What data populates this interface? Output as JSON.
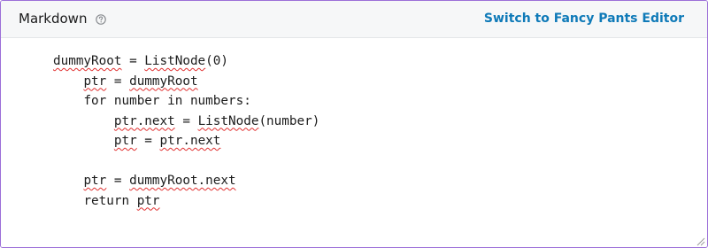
{
  "header": {
    "mode_label": "Markdown",
    "help_icon": "help-circle-icon",
    "switch_label": "Switch to Fancy Pants Editor"
  },
  "editor": {
    "lines": [
      {
        "indent": "",
        "segments": [
          {
            "text": "dummyRoot",
            "misspelled": true
          },
          {
            "text": " = "
          },
          {
            "text": "ListNode",
            "misspelled": true
          },
          {
            "text": "(0)"
          }
        ]
      },
      {
        "indent": "    ",
        "segments": [
          {
            "text": "ptr",
            "misspelled": true
          },
          {
            "text": " = "
          },
          {
            "text": "dummyRoot",
            "misspelled": true
          }
        ]
      },
      {
        "indent": "    ",
        "segments": [
          {
            "text": "for number in numbers:"
          }
        ]
      },
      {
        "indent": "        ",
        "segments": [
          {
            "text": "ptr.next",
            "misspelled": true
          },
          {
            "text": " = "
          },
          {
            "text": "ListNode",
            "misspelled": true
          },
          {
            "text": "(number)"
          }
        ]
      },
      {
        "indent": "        ",
        "segments": [
          {
            "text": "ptr",
            "misspelled": true
          },
          {
            "text": " = "
          },
          {
            "text": "ptr.next",
            "misspelled": true
          }
        ]
      },
      {
        "indent": "",
        "segments": []
      },
      {
        "indent": "    ",
        "segments": [
          {
            "text": "ptr",
            "misspelled": true
          },
          {
            "text": " = "
          },
          {
            "text": "dummyRoot.next",
            "misspelled": true
          }
        ]
      },
      {
        "indent": "    ",
        "segments": [
          {
            "text": "return "
          },
          {
            "text": "ptr",
            "misspelled": true
          }
        ]
      }
    ]
  },
  "colors": {
    "frame_border": "#9c6fd8",
    "header_bg": "#f6f7f8",
    "link": "#0f7ab8",
    "spellcheck_underline": "#e03030"
  }
}
